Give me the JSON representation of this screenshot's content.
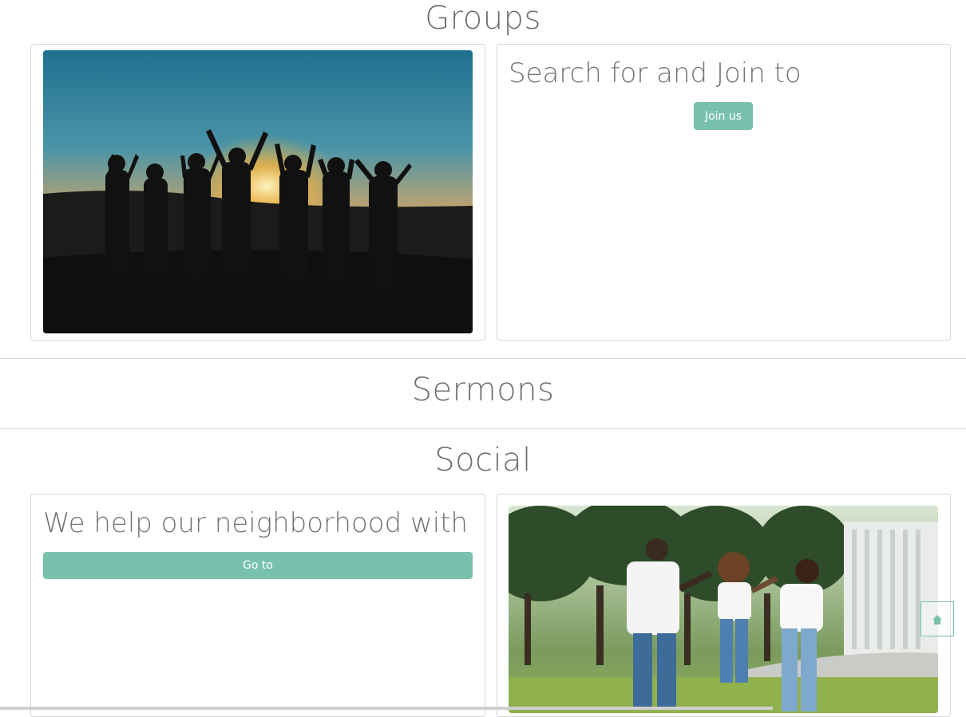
{
  "groups": {
    "title": "Groups",
    "heading": "Search for and Join to",
    "button_label": "Join us"
  },
  "sermons": {
    "title": "Sermons"
  },
  "social": {
    "title": "Social",
    "heading": "We help our neighborhood with",
    "button_label": "Go to"
  },
  "colors": {
    "accent": "#78c2ad",
    "text": "#707070",
    "border": "#d7d7d7"
  },
  "icons": {
    "scroll_top": "home-icon"
  }
}
